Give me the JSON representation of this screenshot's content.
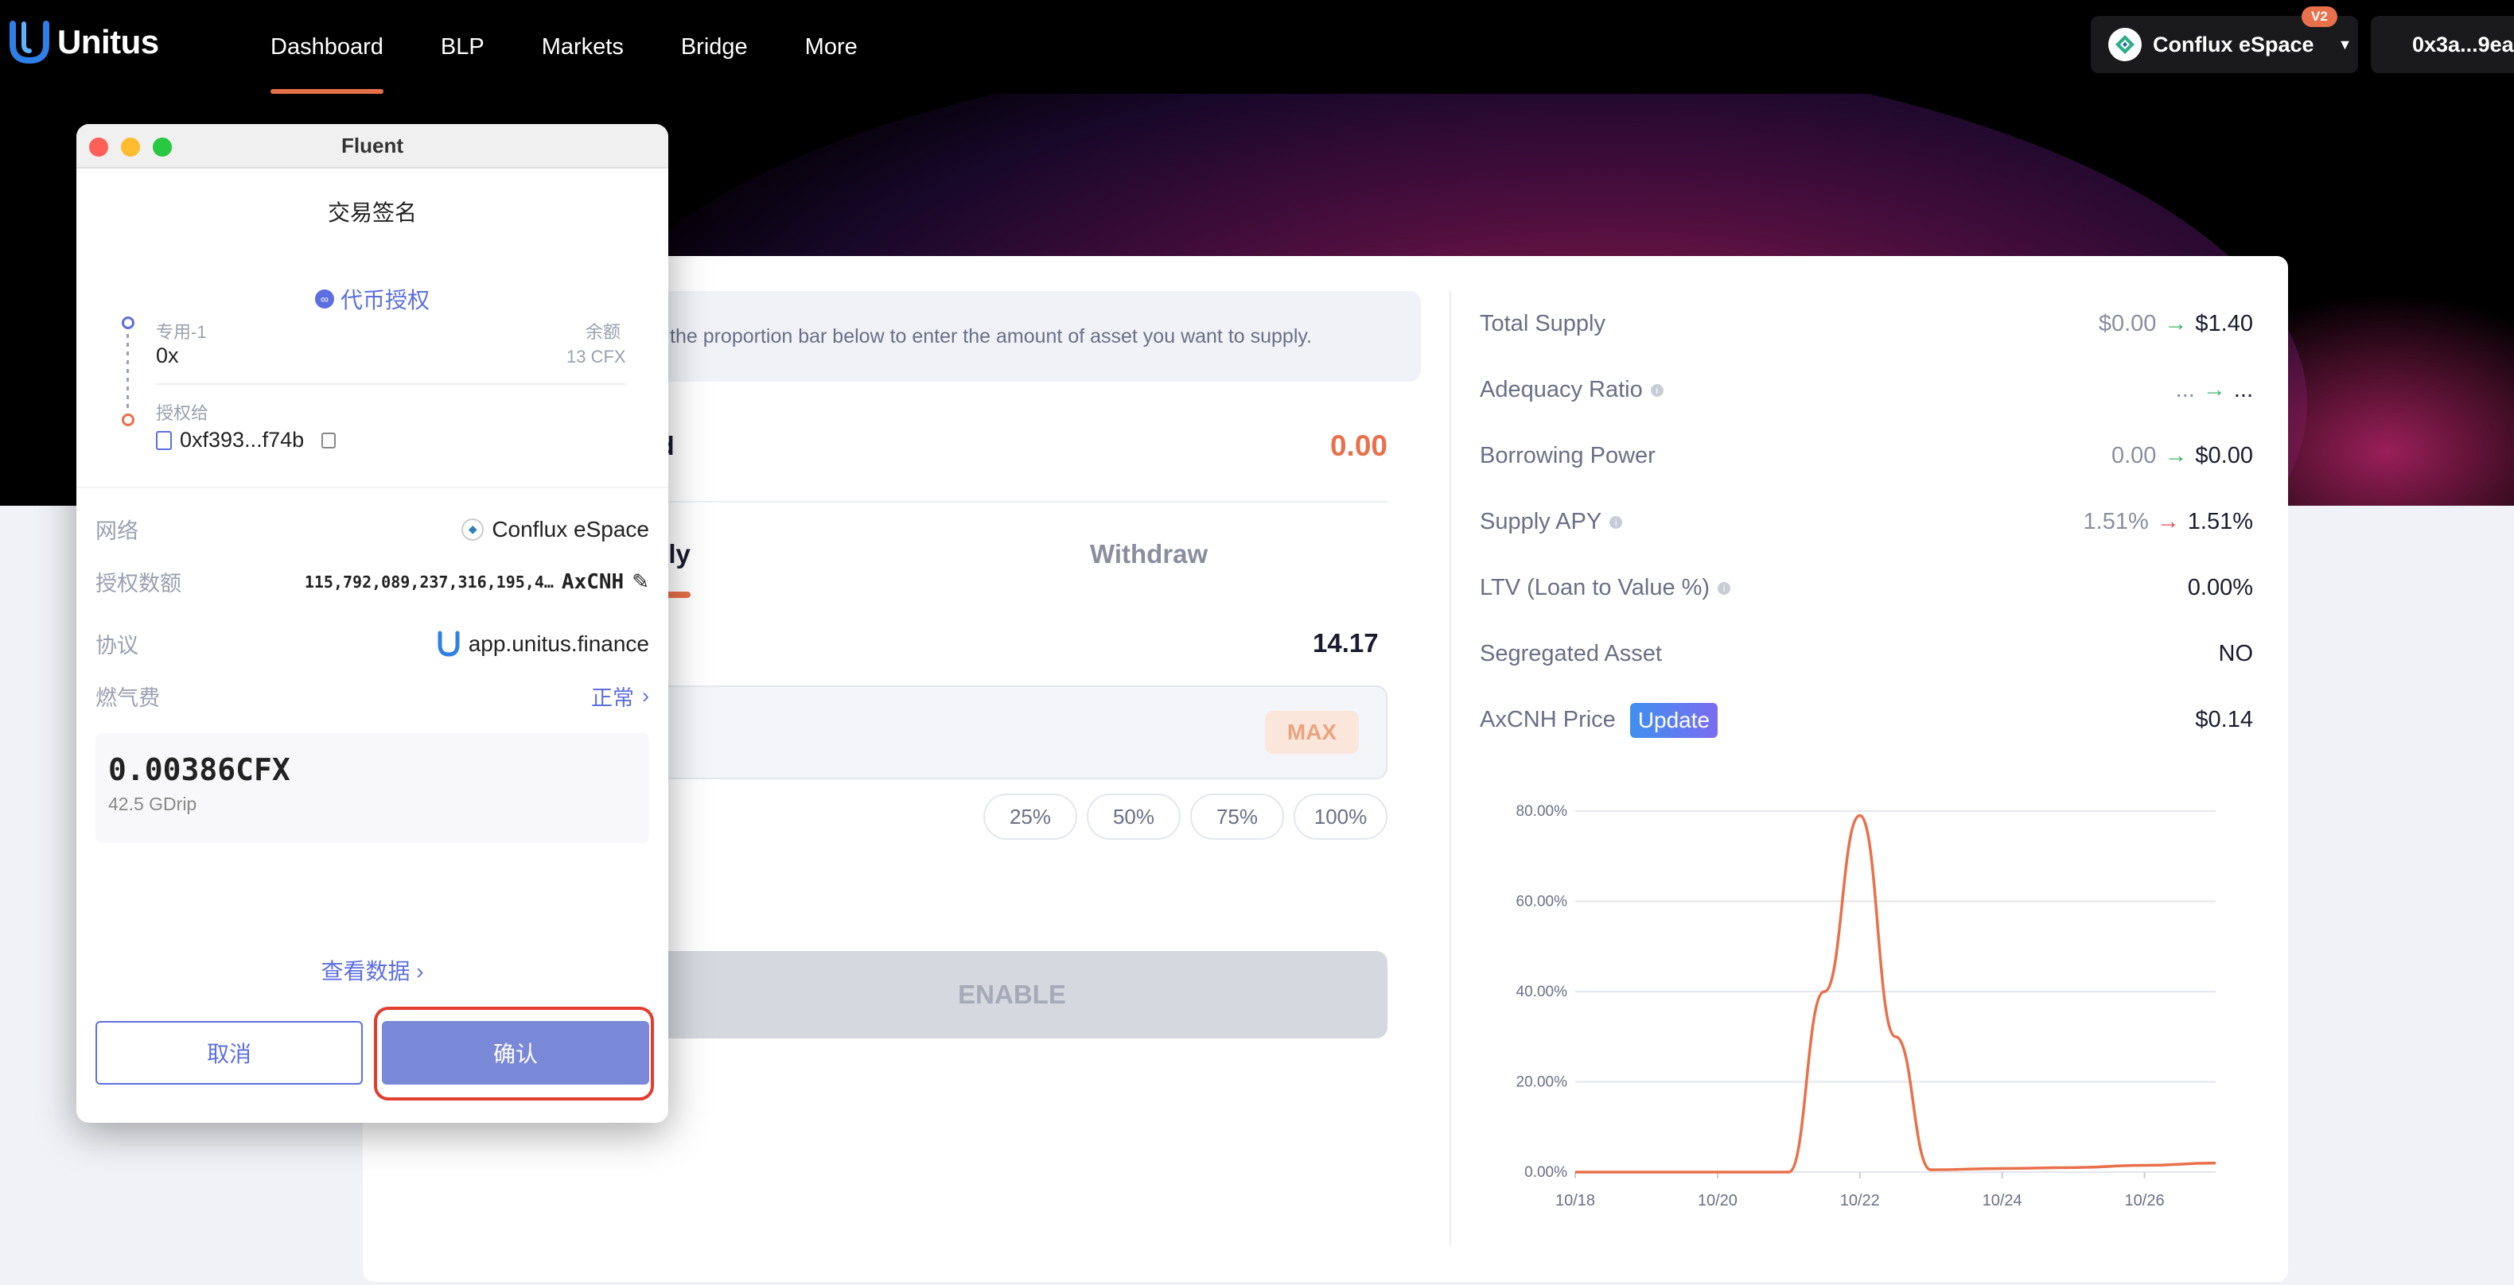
{
  "header": {
    "brand": "Unitus",
    "nav": [
      "Dashboard",
      "BLP",
      "Markets",
      "Bridge",
      "More"
    ],
    "network": "Conflux eSpace",
    "network_badge": "V2",
    "address": "0x3a...9ea"
  },
  "supply": {
    "hint": "the proportion bar below to enter the amount of asset you want to supply.",
    "supplied_label": "ied",
    "supplied_value": "0.00",
    "tab_supply": "pply",
    "tab_withdraw": "Withdraw",
    "balance": "14.17",
    "max_label": "MAX",
    "percent_options": [
      "25%",
      "50%",
      "75%",
      "100%"
    ],
    "enable_label": "ENABLE"
  },
  "stats": [
    {
      "label": "Total Supply",
      "from": "$0.00",
      "to": "$1.40",
      "arrow": "→",
      "arrow_color": "#3ab56a",
      "info": false
    },
    {
      "label": "Adequacy Ratio",
      "from": "...",
      "to": "...",
      "arrow": "→",
      "arrow_color": "#3ab56a",
      "info": true
    },
    {
      "label": "Borrowing Power",
      "from": "0.00",
      "to": "$0.00",
      "arrow": "→",
      "arrow_color": "#3ab56a",
      "info": false
    },
    {
      "label": "Supply APY",
      "from": "1.51%",
      "to": "1.51%",
      "arrow": "→",
      "arrow_color": "#e84a4a",
      "info": true
    },
    {
      "label": "LTV (Loan to Value %)",
      "from": "",
      "to": "0.00%",
      "arrow": "",
      "info": true
    },
    {
      "label": "Segregated Asset",
      "from": "",
      "to": "NO",
      "arrow": "",
      "info": false
    },
    {
      "label": "AxCNH Price",
      "from": "",
      "to": "$0.14",
      "arrow": "",
      "info": false,
      "button": "Update"
    }
  ],
  "chart_data": {
    "type": "line",
    "x": [
      "10/18",
      "10/19",
      "10/20",
      "10/21",
      "10/21.5",
      "10/22",
      "10/22.5",
      "10/23",
      "10/24",
      "10/25",
      "10/26",
      "10/27"
    ],
    "x_ticks": [
      "10/18",
      "10/20",
      "10/22",
      "10/24",
      "10/26"
    ],
    "y_ticks": [
      "0.00%",
      "20.00%",
      "40.00%",
      "60.00%",
      "80.00%"
    ],
    "ylim": [
      0,
      80
    ],
    "series": [
      {
        "values": [
          0,
          0,
          0,
          0,
          40,
          79,
          30,
          0.5,
          0.8,
          1.0,
          1.5,
          2.0
        ],
        "color": "#e8704a"
      }
    ],
    "grid": true
  },
  "popup": {
    "window_title": "Fluent",
    "heading": "交易签名",
    "action": "代币授权",
    "from_label": "专用-1",
    "from_value": "0x",
    "balance_label": "余额",
    "balance_value": "13 CFX",
    "to_label": "授权给",
    "to_value": "0xf393...f74b",
    "network_label": "网络",
    "network_value": "Conflux eSpace",
    "amount_label": "授权数额",
    "amount_value": "115,792,089,237,316,195,4…",
    "amount_token": "AxCNH",
    "protocol_label": "协议",
    "protocol_value": "app.unitus.finance",
    "gas_label": "燃气费",
    "gas_level": "正常",
    "gas_amount": "0.00386CFX",
    "gas_sub": "42.5 GDrip",
    "view_data": "查看数据",
    "cancel": "取消",
    "confirm": "确认"
  }
}
